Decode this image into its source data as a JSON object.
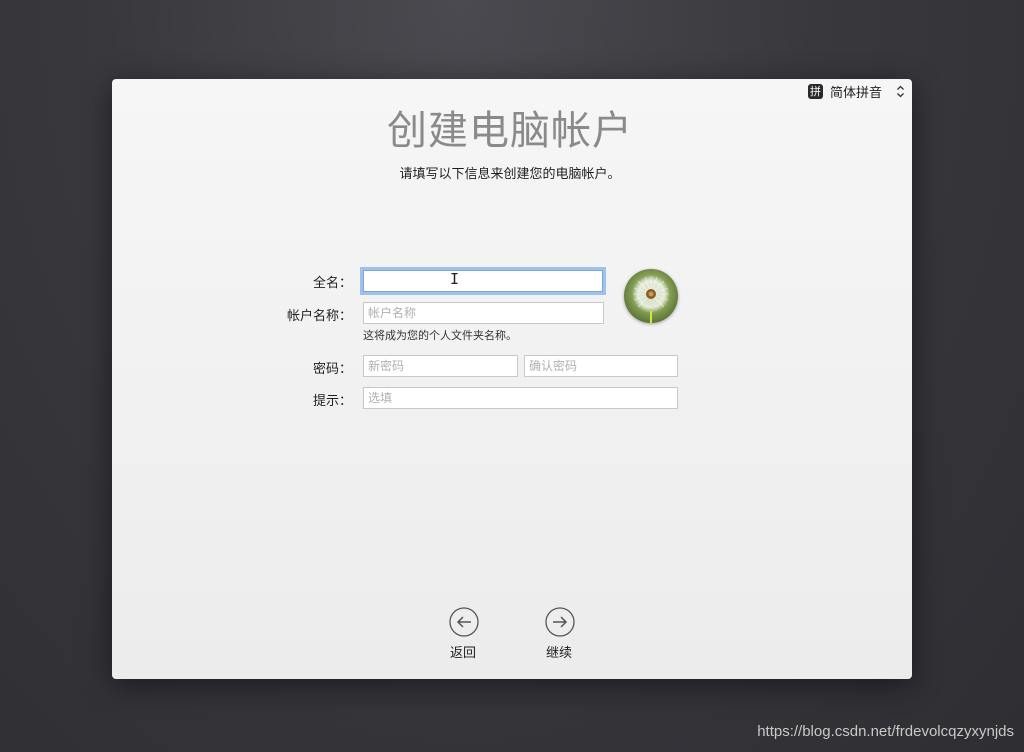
{
  "input_menu": {
    "badge": "拼",
    "label": "简体拼音",
    "icon": "updown-chevron-icon"
  },
  "title": "创建电脑帐户",
  "subtitle": "请填写以下信息来创建您的电脑帐户。",
  "form": {
    "full_name_label": "全名：",
    "full_name_value": "",
    "account_name_label": "帐户名称：",
    "account_name_placeholder": "帐户名称",
    "account_hint": "这将成为您的个人文件夹名称。",
    "password_label": "密码：",
    "password_placeholder": "新密码",
    "verify_placeholder": "确认密码",
    "hint_label": "提示：",
    "hint_placeholder": "选填"
  },
  "avatar": {
    "icon": "dandelion-avatar"
  },
  "nav": {
    "back_label": "返回",
    "continue_label": "继续"
  },
  "watermark": "https://blog.csdn.net/frdevolcqzyxynjds",
  "colors": {
    "background": "#38383d",
    "panel": "#f0f0f0",
    "focus_ring": "#9dc2ee",
    "title": "#8a8a8a"
  }
}
